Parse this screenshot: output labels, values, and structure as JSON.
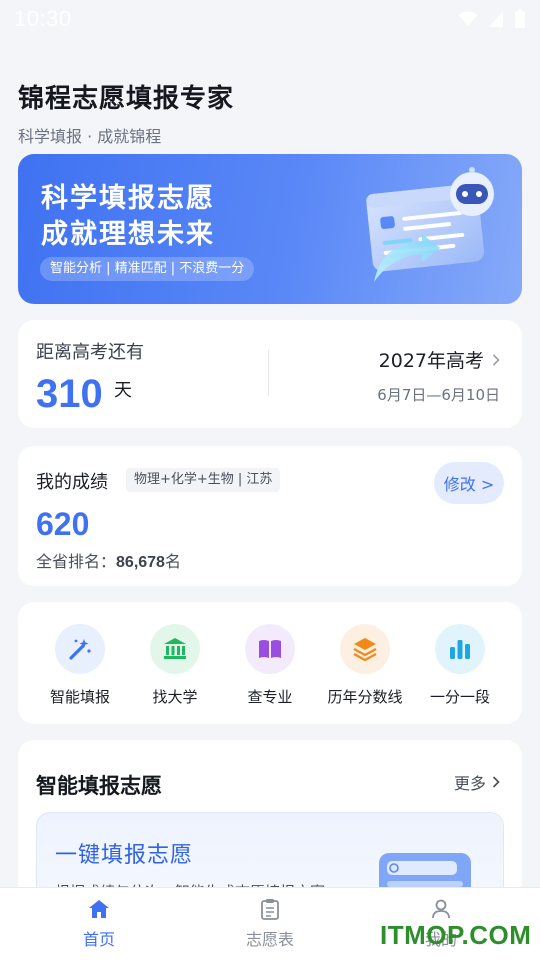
{
  "status_bar": {
    "time": "10:30"
  },
  "header": {
    "title": "锦程志愿填报专家",
    "subtitle": "科学填报 · 成就锦程"
  },
  "banner": {
    "line1": "科学填报志愿",
    "line2": "成就理想未来",
    "tag": "智能分析 | 精准匹配 | 不浪费一分",
    "colors": {
      "start": "#3f72f2",
      "end": "#86aaf9"
    }
  },
  "countdown": {
    "label": "距离高考还有",
    "days": "310",
    "unit": "天",
    "exam": "2027年高考",
    "dates": "6月7日—6月10日"
  },
  "score": {
    "label": "我的成绩",
    "subjects": "物理+化学+生物 | 江苏",
    "edit_label": "修改 >",
    "value": "620",
    "rank_label": "全省排名：",
    "rank_value": "86,678",
    "rank_suffix": "名"
  },
  "quick_actions": [
    {
      "label": "智能填报",
      "icon": "magic-wand-icon",
      "color": "#3f72f2",
      "bg": "#e8effd"
    },
    {
      "label": "找大学",
      "icon": "university-icon",
      "color": "#1fb860",
      "bg": "#e3f6ea"
    },
    {
      "label": "查专业",
      "icon": "book-icon",
      "color": "#9a4ee0",
      "bg": "#f3eafc"
    },
    {
      "label": "历年分数线",
      "icon": "layers-icon",
      "color": "#f28a1a",
      "bg": "#fdf0e3"
    },
    {
      "label": "一分一段",
      "icon": "bar-chart-icon",
      "color": "#1fa6e0",
      "bg": "#e2f4fb"
    }
  ],
  "smart_section": {
    "title": "智能填报志愿",
    "more": "更多",
    "feature_title": "一键填报志愿",
    "feature_desc": "根据成绩与位次，智能生成志愿填报方案"
  },
  "tab_bar": [
    {
      "label": "首页",
      "icon": "home-icon",
      "active": true
    },
    {
      "label": "志愿表",
      "icon": "clipboard-icon",
      "active": false
    },
    {
      "label": "我的",
      "icon": "user-icon",
      "active": false
    }
  ],
  "watermark": "ITMOP.COM",
  "colors": {
    "accent": "#3f72f2",
    "background": "#f3f5f9"
  }
}
